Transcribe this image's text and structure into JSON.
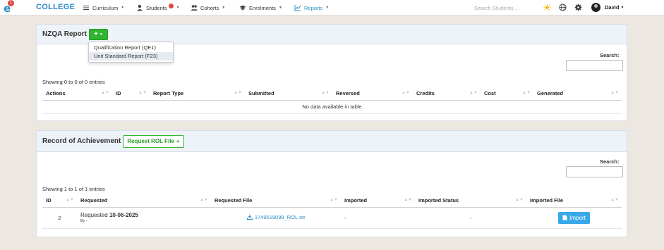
{
  "navbar": {
    "logo_badge": "1",
    "brand": "COLLEGE",
    "items": [
      {
        "label": "Curriculum"
      },
      {
        "label": "Students",
        "badge": ""
      },
      {
        "label": "Cohorts"
      },
      {
        "label": "Enrolments"
      },
      {
        "label": "Reports"
      }
    ],
    "search_placeholder": "Search Students....",
    "user_name": "David",
    "accent_color": "#2a8cc9"
  },
  "nzqa": {
    "title": "NZQA Report",
    "add_button": "+",
    "dropdown": [
      "Qualification Report (QE1)",
      "Unit Standard Report (F23)"
    ],
    "search_label": "Search:",
    "info": "Showing 0 to 0 of 0 entries",
    "columns": [
      "Actions",
      "ID",
      "Report Type",
      "Submitted",
      "Reversed",
      "Credits",
      "Cost",
      "Generated"
    ],
    "empty_message": "No data available in table"
  },
  "rol": {
    "title": "Record of Achievement",
    "request_button": "Request ROL File",
    "request_icon": "+",
    "search_label": "Search:",
    "info": "Showing 1 to 1 of 1 entries",
    "columns": [
      "ID",
      "Requested",
      "Requested File",
      "Imported",
      "Imported Status",
      "Imported File"
    ],
    "row": {
      "id": "2",
      "requested_prefix": "Requested",
      "requested_date": "10-06-2025",
      "requested_by": "By -",
      "file": "1749519099_ROL.txt",
      "imported": "-",
      "imported_status": "-",
      "import_button": "Import"
    }
  }
}
